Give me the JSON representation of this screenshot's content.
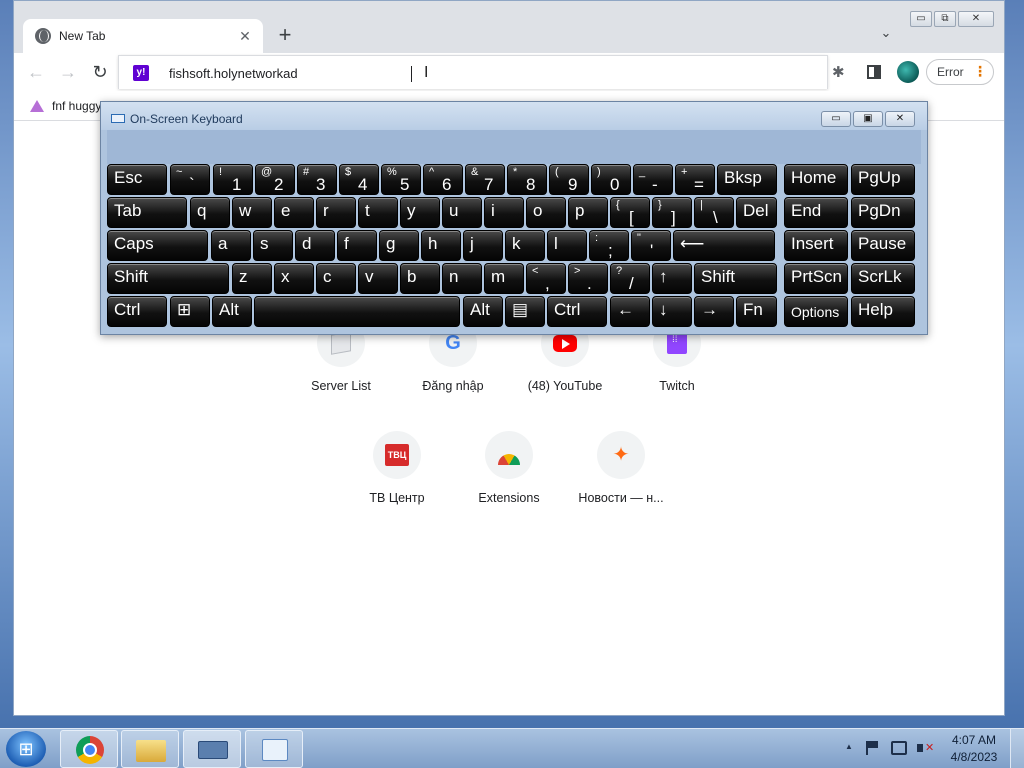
{
  "browser": {
    "tab_title": "New Tab",
    "tab_close": "✕",
    "new_tab": "+",
    "tab_search": "⌄",
    "window_controls": {
      "minimize": "▭",
      "restore": "⧉",
      "close": "✕"
    },
    "nav": {
      "back": "←",
      "forward": "→",
      "reload": "↻"
    },
    "address_value": "fishsoft.holynetworkad",
    "address_favicon": "y!",
    "error_label": "Error",
    "error_menu": "⋮",
    "bookmarks": [
      {
        "label": "fnf huggy"
      }
    ]
  },
  "shortcuts": [
    {
      "label": "Server List",
      "icon": "server-icon"
    },
    {
      "label": "Đăng nhập",
      "icon": "google-icon",
      "glyph": "G"
    },
    {
      "label": "(48) YouTube",
      "icon": "youtube-icon"
    },
    {
      "label": "Twitch",
      "icon": "twitch-icon"
    },
    {
      "label": "ТВ Центр",
      "icon": "tvc-icon",
      "glyph": "ТВЦ"
    },
    {
      "label": "Extensions",
      "icon": "extensions-icon"
    },
    {
      "label": "Новости — н...",
      "icon": "news-icon",
      "glyph": "✦"
    }
  ],
  "osk": {
    "title": "On-Screen Keyboard",
    "controls": {
      "minimize": "▭",
      "restore": "▣",
      "close": "✕"
    },
    "rows": [
      [
        {
          "main": "Esc"
        },
        {
          "sub": "~",
          "dig": "`"
        },
        {
          "sub": "!",
          "dig": "1"
        },
        {
          "sub": "@",
          "dig": "2"
        },
        {
          "sub": "#",
          "dig": "3"
        },
        {
          "sub": "$",
          "dig": "4"
        },
        {
          "sub": "%",
          "dig": "5"
        },
        {
          "sub": "^",
          "dig": "6"
        },
        {
          "sub": "&",
          "dig": "7"
        },
        {
          "sub": "*",
          "dig": "8"
        },
        {
          "sub": "(",
          "dig": "9"
        },
        {
          "sub": ")",
          "dig": "0"
        },
        {
          "sub": "_",
          "dig": "-"
        },
        {
          "sub": "+",
          "dig": "="
        },
        {
          "main": "Bksp"
        },
        {
          "main": "Home"
        },
        {
          "main": "PgUp"
        }
      ],
      [
        {
          "main": "Tab"
        },
        {
          "main": "q"
        },
        {
          "main": "w"
        },
        {
          "main": "e"
        },
        {
          "main": "r"
        },
        {
          "main": "t"
        },
        {
          "main": "y"
        },
        {
          "main": "u"
        },
        {
          "main": "i"
        },
        {
          "main": "o"
        },
        {
          "main": "p"
        },
        {
          "sub": "{",
          "dig": "["
        },
        {
          "sub": "}",
          "dig": "]"
        },
        {
          "sub": "|",
          "dig": "\\"
        },
        {
          "main": "Del"
        },
        {
          "main": "End"
        },
        {
          "main": "PgDn"
        }
      ],
      [
        {
          "main": "Caps"
        },
        {
          "main": "a"
        },
        {
          "main": "s"
        },
        {
          "main": "d"
        },
        {
          "main": "f"
        },
        {
          "main": "g"
        },
        {
          "main": "h"
        },
        {
          "main": "j"
        },
        {
          "main": "k"
        },
        {
          "main": "l"
        },
        {
          "sub": ":",
          "dig": ";"
        },
        {
          "sub": "\"",
          "dig": "'"
        },
        {
          "main": "⟵"
        },
        {
          "main": "Insert"
        },
        {
          "main": "Pause"
        }
      ],
      [
        {
          "main": "Shift"
        },
        {
          "main": "z"
        },
        {
          "main": "x"
        },
        {
          "main": "c"
        },
        {
          "main": "v"
        },
        {
          "main": "b"
        },
        {
          "main": "n"
        },
        {
          "main": "m"
        },
        {
          "sub": "<",
          "dig": ","
        },
        {
          "sub": ">",
          "dig": "."
        },
        {
          "sub": "?",
          "dig": "/"
        },
        {
          "main": "↑"
        },
        {
          "main": "Shift"
        },
        {
          "main": "PrtScn"
        },
        {
          "main": "ScrLk"
        }
      ],
      [
        {
          "main": "Ctrl"
        },
        {
          "main": "⊞"
        },
        {
          "main": "Alt"
        },
        {
          "main": ""
        },
        {
          "main": "Alt"
        },
        {
          "main": "▤"
        },
        {
          "main": "Ctrl"
        },
        {
          "main": "←"
        },
        {
          "main": "↓"
        },
        {
          "main": "→"
        },
        {
          "main": "Fn"
        },
        {
          "main": "Options"
        },
        {
          "main": "Help"
        }
      ]
    ]
  },
  "taskbar": {
    "start": "⊞",
    "apps": [
      {
        "name": "chrome-icon"
      },
      {
        "name": "explorer-icon"
      },
      {
        "name": "onscreen-keyboard-icon"
      },
      {
        "name": "control-panel-icon"
      }
    ],
    "tray": {
      "expand": "▲",
      "time": "4:07 AM",
      "date": "4/8/2023"
    }
  }
}
